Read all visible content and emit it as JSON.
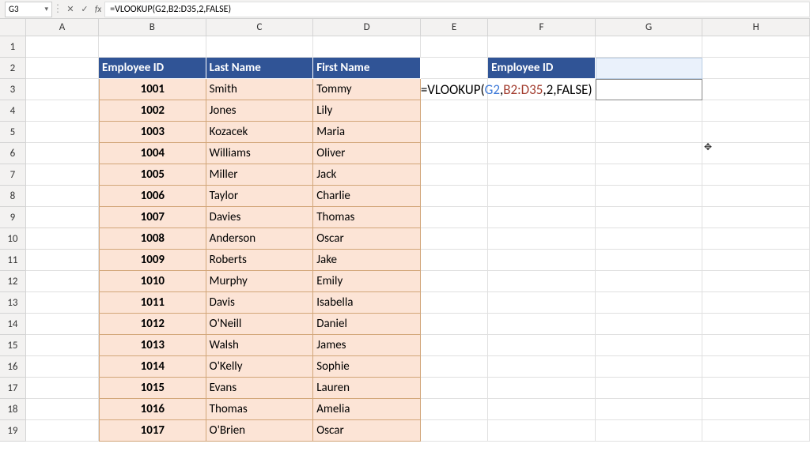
{
  "nameBox": "G3",
  "formulaBar": "=VLOOKUP(G2,B2:D35,2,FALSE)",
  "columns": [
    "A",
    "B",
    "C",
    "D",
    "E",
    "F",
    "G",
    "H"
  ],
  "headers": {
    "empId": "Employee ID",
    "lastName": "Last Name",
    "firstName": "First Name"
  },
  "lookupHeader": "Employee ID",
  "rows": [
    {
      "n": 1
    },
    {
      "n": 2
    },
    {
      "n": 3,
      "id": "1001",
      "last": "Smith",
      "first": "Tommy"
    },
    {
      "n": 4,
      "id": "1002",
      "last": "Jones",
      "first": "Lily"
    },
    {
      "n": 5,
      "id": "1003",
      "last": "Kozacek",
      "first": "Maria"
    },
    {
      "n": 6,
      "id": "1004",
      "last": "Williams",
      "first": "Oliver"
    },
    {
      "n": 7,
      "id": "1005",
      "last": "Miller",
      "first": "Jack"
    },
    {
      "n": 8,
      "id": "1006",
      "last": "Taylor",
      "first": "Charlie"
    },
    {
      "n": 9,
      "id": "1007",
      "last": "Davies",
      "first": "Thomas"
    },
    {
      "n": 10,
      "id": "1008",
      "last": "Anderson",
      "first": "Oscar"
    },
    {
      "n": 11,
      "id": "1009",
      "last": "Roberts",
      "first": "Jake"
    },
    {
      "n": 12,
      "id": "1010",
      "last": "Murphy",
      "first": "Emily"
    },
    {
      "n": 13,
      "id": "1011",
      "last": "Davis",
      "first": "Isabella"
    },
    {
      "n": 14,
      "id": "1012",
      "last": "O'Neill",
      "first": "Daniel"
    },
    {
      "n": 15,
      "id": "1013",
      "last": "Walsh",
      "first": "James"
    },
    {
      "n": 16,
      "id": "1014",
      "last": "O'Kelly",
      "first": "Sophie"
    },
    {
      "n": 17,
      "id": "1015",
      "last": "Evans",
      "first": "Lauren"
    },
    {
      "n": 18,
      "id": "1016",
      "last": "Thomas",
      "first": "Amelia"
    },
    {
      "n": 19,
      "id": "1017",
      "last": "O'Brien",
      "first": "Oscar"
    }
  ],
  "cellFormula": {
    "prefix": "=VLOOKUP(",
    "arg1": "G2",
    "sep1": ",",
    "arg2": "B2:D35",
    "sep2": ",",
    "arg3": "2",
    "sep3": ",",
    "arg4": "FALSE",
    "suffix": ")"
  },
  "cursorGlyph": "✥"
}
